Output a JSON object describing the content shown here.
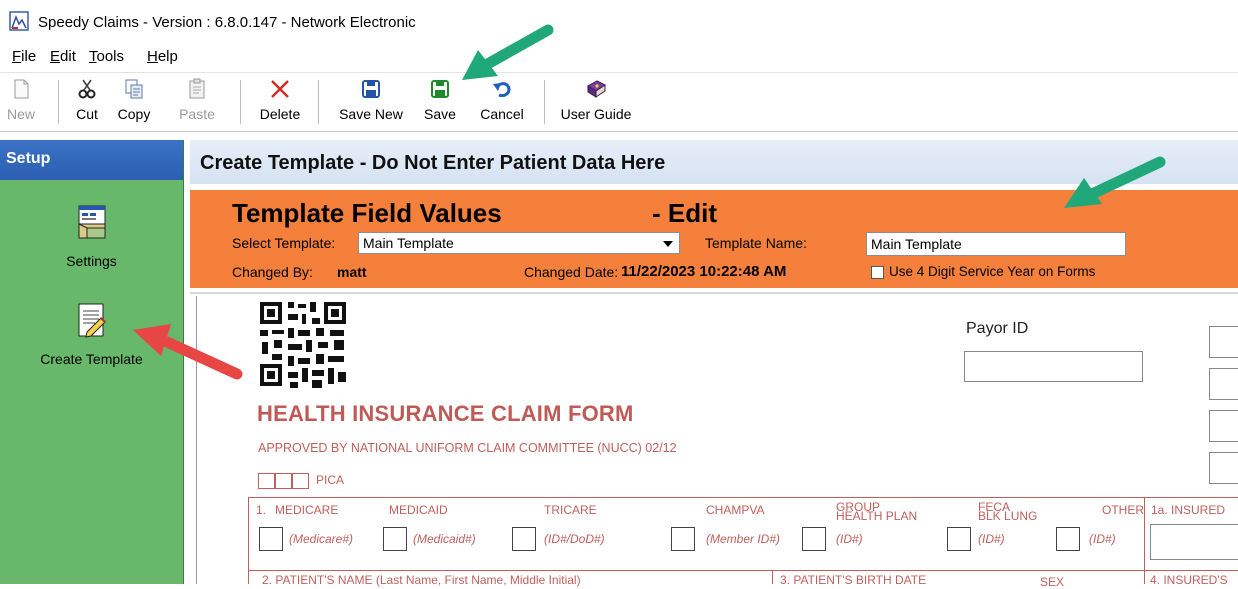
{
  "window": {
    "title": "Speedy Claims - Version : 6.8.0.147 - Network Electronic"
  },
  "menu": {
    "items": [
      {
        "label": "File",
        "key": "F",
        "rest": "ile"
      },
      {
        "label": "Edit",
        "key": "E",
        "rest": "dit"
      },
      {
        "label": "Tools",
        "key": "T",
        "rest": "ools"
      },
      {
        "label": "Help",
        "key": "H",
        "rest": "elp"
      }
    ]
  },
  "toolbar": {
    "new_label": "New",
    "cut_label": "Cut",
    "copy_label": "Copy",
    "paste_label": "Paste",
    "delete_label": "Delete",
    "save_new_label": "Save New",
    "save_label": "Save",
    "cancel_label": "Cancel",
    "user_guide_label": "User Guide"
  },
  "sidebar": {
    "header": "Setup",
    "items": [
      {
        "label": "Settings",
        "icon": "settings-window-icon"
      },
      {
        "label": "Create Template",
        "icon": "template-pencil-icon"
      }
    ]
  },
  "main": {
    "header": "Create Template - Do Not Enter Patient Data Here",
    "panel_title": "Template Field Values",
    "panel_mode": "- Edit",
    "select_template_label": "Select Template:",
    "select_template_value": "Main Template",
    "template_name_label": "Template Name:",
    "template_name_value": "Main Template",
    "changed_by_label": "Changed By:",
    "changed_by_value": "matt",
    "changed_date_label": "Changed Date:",
    "changed_date_value": "11/22/2023 10:22:48 AM",
    "use4digit_label": "Use 4 Digit Service Year on Forms",
    "use4digit_checked": false
  },
  "form": {
    "title": "HEALTH INSURANCE CLAIM FORM",
    "approved": "APPROVED BY NATIONAL UNIFORM CLAIM COMMITTEE (NUCC) 02/12",
    "pica": "PICA",
    "payor_id_label": "Payor ID",
    "row1_num": "1.",
    "programs": [
      {
        "label": "MEDICARE",
        "id": "(Medicare#)"
      },
      {
        "label": "MEDICAID",
        "id": "(Medicaid#)"
      },
      {
        "label": "TRICARE",
        "id": "(ID#/DoD#)"
      },
      {
        "label": "CHAMPVA",
        "id": "(Member ID#)"
      },
      {
        "label": "GROUP HEALTH PLAN",
        "line1": "GROUP",
        "line2": "HEALTH PLAN",
        "id": "(ID#)"
      },
      {
        "label": "FECA BLK LUNG",
        "line1": "FECA",
        "line2": "BLK LUNG",
        "id": "(ID#)"
      },
      {
        "label": "OTHER",
        "id": "(ID#)"
      }
    ],
    "insured_id": "1a. INSURED",
    "patient_name": "2. PATIENT'S NAME (Last Name, First Name, Middle Initial)",
    "birth_date": "3. PATIENT'S BIRTH DATE",
    "sex": "SEX",
    "insured_name": "4. INSURED'S"
  },
  "colors": {
    "sidebar": "#67b86a",
    "sidebar_header": "#2b5fb0",
    "orange_panel": "#f4803c",
    "form_red": "#c0605d",
    "arrow_green": "#20a77a",
    "arrow_red": "#e84545"
  }
}
